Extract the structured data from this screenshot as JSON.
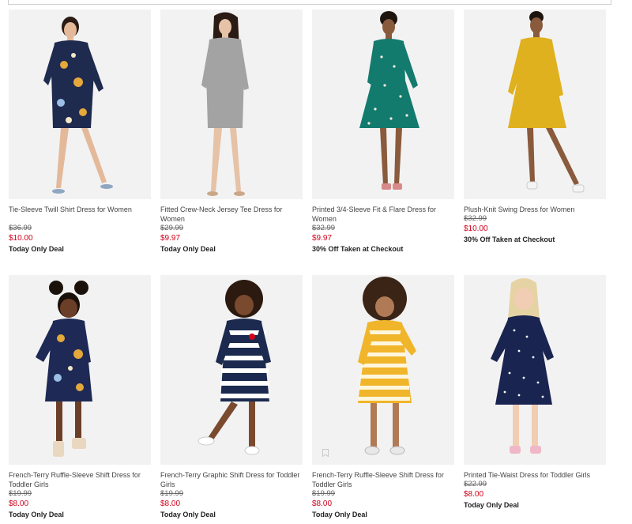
{
  "products": [
    {
      "name": "Tie-Sleeve Twill Shirt Dress for Women",
      "original_price": "$36.99",
      "sale_price": "$10.00",
      "deal": "Today Only Deal",
      "dress_color": "#1f2a4f",
      "pattern": "floral-navy"
    },
    {
      "name": "Fitted Crew-Neck Jersey Tee Dress for Women",
      "original_price": "$29.99",
      "sale_price": "$9.97",
      "deal": "Today Only Deal",
      "dress_color": "#9a9a9a",
      "pattern": "heather-gray"
    },
    {
      "name": "Printed 3/4-Sleeve Fit & Flare Dress for Women",
      "original_price": "$32.99",
      "sale_price": "$9.97",
      "deal": "30% Off Taken at Checkout",
      "dress_color": "#137a6e",
      "pattern": "dots-teal"
    },
    {
      "name": "Plush-Knit Swing Dress for Women",
      "original_price": "$32.99",
      "sale_price": "$10.00",
      "deal": "30% Off Taken at Checkout",
      "dress_color": "#e0b11f",
      "pattern": "solid-yellow"
    },
    {
      "name": "French-Terry Ruffle-Sleeve Shift Dress for Toddler Girls",
      "original_price": "$19.99",
      "sale_price": "$8.00",
      "deal": "Today Only Deal",
      "dress_color": "#1e2a55",
      "pattern": "floral-navy"
    },
    {
      "name": "French-Terry Graphic Shift Dress for Toddler Girls",
      "original_price": "$19.99",
      "sale_price": "$8.00",
      "deal": "Today Only Deal",
      "dress_color": "#1b2a4e",
      "pattern": "navy-white-stripes"
    },
    {
      "name": "French-Terry Ruffle-Sleeve Shift Dress for Toddler Girls",
      "original_price": "$19.99",
      "sale_price": "$8.00",
      "deal": "Today Only Deal",
      "dress_color": "#f0b52a",
      "pattern": "yellow-white-stripes"
    },
    {
      "name": "Printed Tie-Waist Dress for Toddler Girls",
      "original_price": "$22.99",
      "sale_price": "$8.00",
      "deal": "Today Only Deal",
      "dress_color": "#1a2450",
      "pattern": "dots-navy"
    }
  ],
  "icons": {
    "save": "bookmark-icon"
  }
}
